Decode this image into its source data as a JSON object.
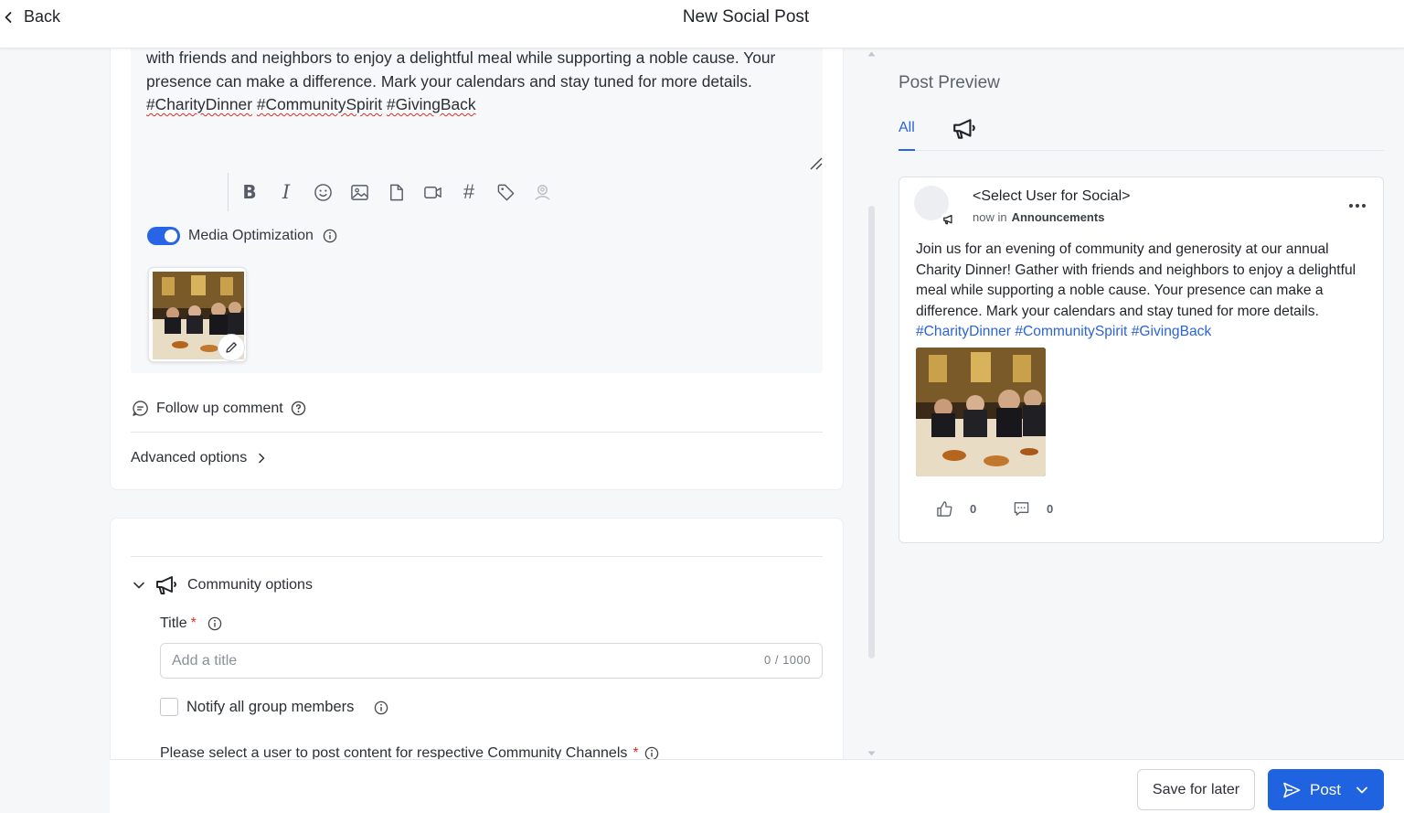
{
  "header": {
    "back_label": "Back",
    "title": "New Social Post"
  },
  "editor": {
    "text_line1": "with friends and neighbors to enjoy a delightful meal while supporting a noble cause. Your",
    "text_line2": "presence can make a difference. Mark your calendars and stay tuned for more details.",
    "hashtags": [
      "#CharityDinner",
      "#CommunitySpirit",
      "#GivingBack"
    ],
    "toolbar": [
      "bold-button",
      "italic-button",
      "emoji-button",
      "image-button",
      "file-button",
      "video-button",
      "hashtag-button",
      "tag-button",
      "mention-user-button"
    ],
    "media_optimization_label": "Media Optimization",
    "media_optimization_on": true
  },
  "follow_up": {
    "label": "Follow up comment"
  },
  "advanced": {
    "label": "Advanced options"
  },
  "community": {
    "header_label": "Community options",
    "title_label": "Title",
    "title_required": "*",
    "title_placeholder": "Add a title",
    "title_counter": "0 / 1000",
    "notify_label": "Notify all group members",
    "select_user_label": "Please select a user to post content for respective Community Channels",
    "select_user_required": "*"
  },
  "preview": {
    "title": "Post Preview",
    "tab_all": "All",
    "user": "<Select User for Social>",
    "meta_time": "now in",
    "meta_channel": "Announcements",
    "body": "Join us for an evening of community and generosity at our annual Charity Dinner! Gather with friends and neighbors to enjoy a delightful meal while supporting a noble cause. Your presence can make a difference. Mark your calendars and stay tuned for more details.",
    "hashtags": "#CharityDinner #CommunitySpirit #GivingBack",
    "likes": "0",
    "comments": "0"
  },
  "footer": {
    "save_label": "Save for later",
    "post_label": "Post"
  },
  "colors": {
    "accent": "#1f63e0",
    "link": "#2b63d9",
    "required": "#d93025"
  }
}
